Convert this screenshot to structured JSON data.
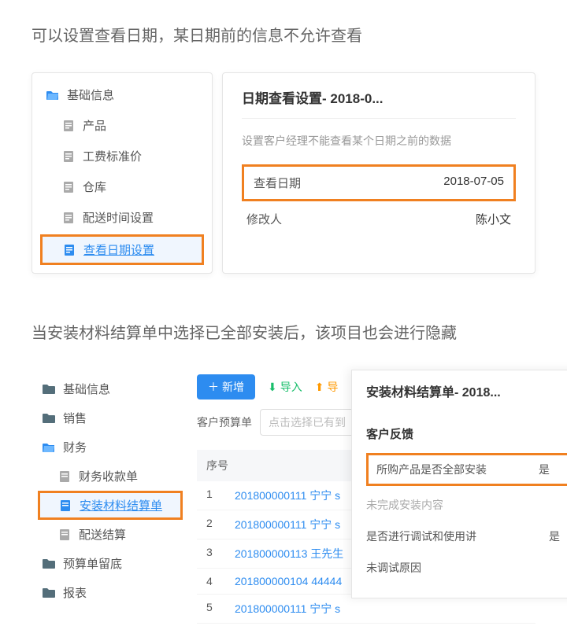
{
  "section1": {
    "caption": "可以设置查看日期，某日期前的信息不允许查看",
    "nav": {
      "root": "基础信息",
      "items": [
        "产品",
        "工费标准价",
        "仓库",
        "配送时间设置",
        "查看日期设置"
      ]
    },
    "detail": {
      "title": "日期查看设置- 2018-0...",
      "desc": "设置客户经理不能查看某个日期之前的数据",
      "row1_label": "查看日期",
      "row1_value": "2018-07-05",
      "row2_label": "修改人",
      "row2_value": "陈小文"
    }
  },
  "section2": {
    "caption": "当安装材料结算单中选择已全部安装后，该项目也会进行隐藏",
    "nav": {
      "items": [
        {
          "label": "基础信息",
          "icon": "folder",
          "open": false
        },
        {
          "label": "销售",
          "icon": "folder",
          "open": false
        },
        {
          "label": "财务",
          "icon": "folder",
          "open": true
        },
        {
          "label": "财务收款单",
          "icon": "doc",
          "indent": true
        },
        {
          "label": "安装材料结算单",
          "icon": "doc",
          "indent": true,
          "selected": true,
          "highlight": true
        },
        {
          "label": "配送结算",
          "icon": "doc",
          "indent": true
        },
        {
          "label": "预算单留底",
          "icon": "folder",
          "open": false
        },
        {
          "label": "报表",
          "icon": "folder",
          "open": false
        }
      ]
    },
    "toolbar": {
      "add": "新增",
      "import": "导入",
      "export": "导"
    },
    "filter": {
      "label": "客户预算单",
      "placeholder": "点击选择已有到"
    },
    "table": {
      "header": "序号",
      "rows": [
        {
          "idx": "1",
          "link": "201800000111 宁宁 s"
        },
        {
          "idx": "2",
          "link": "201800000111 宁宁 s"
        },
        {
          "idx": "3",
          "link": "201800000113 王先生"
        },
        {
          "idx": "4",
          "link": "201800000104 44444"
        },
        {
          "idx": "5",
          "link": "201800000111 宁宁 s"
        }
      ]
    },
    "overlay": {
      "title": "安装材料结算单- 2018...",
      "sub": "客户反馈",
      "rows": [
        {
          "label": "所购产品是否全部安装",
          "value": "是",
          "highlight": true
        },
        {
          "label": "未完成安装内容",
          "value": "",
          "muted": true
        },
        {
          "label": "是否进行调试和使用讲",
          "value": "是"
        },
        {
          "label": "未调试原因",
          "value": ""
        }
      ]
    }
  }
}
